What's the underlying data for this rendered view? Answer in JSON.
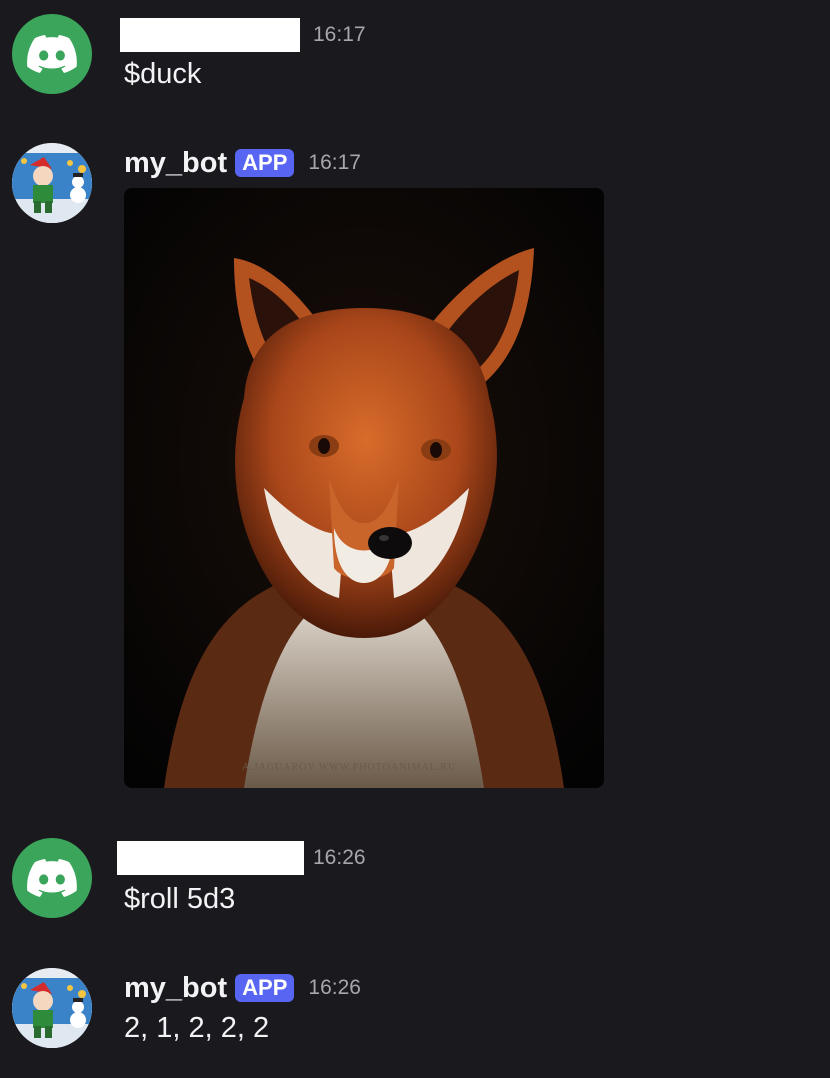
{
  "messages": [
    {
      "author_redacted": true,
      "time": "16:17",
      "content": "$duck",
      "avatar_icon": "discord-logo-icon"
    },
    {
      "author": "my_bot",
      "badge": "APP",
      "time": "16:17",
      "attachment": {
        "subject": "red fox portrait photo",
        "watermark": "A.JAGUAROV WWW.PHOTOANIMAL.RU"
      },
      "avatar_icon": "bot-avatar-icon"
    },
    {
      "author_redacted": true,
      "time": "16:26",
      "content": "$roll 5d3",
      "avatar_icon": "discord-logo-icon"
    },
    {
      "author": "my_bot",
      "badge": "APP",
      "time": "16:26",
      "content": "2, 1, 2, 2, 2",
      "avatar_icon": "bot-avatar-icon"
    }
  ],
  "colors": {
    "background": "#1a1a1e",
    "discord_avatar": "#3ba55c",
    "app_badge": "#5865f2",
    "timestamp": "#a5a7ad"
  }
}
